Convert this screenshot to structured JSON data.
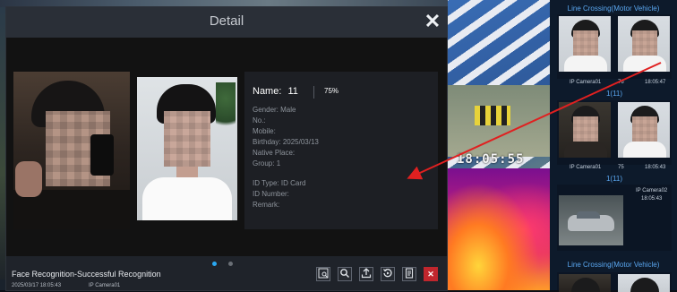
{
  "dialog": {
    "title": "Detail",
    "close_icon": "close-icon",
    "name_label": "Name:",
    "name_value": "11",
    "similarity": "75%",
    "fields": [
      {
        "label": "Gender:",
        "value": "Male"
      },
      {
        "label": "No.:",
        "value": ""
      },
      {
        "label": "Mobile:",
        "value": ""
      },
      {
        "label": "Birthday:",
        "value": "2025/03/13"
      },
      {
        "label": "Native Place:",
        "value": ""
      },
      {
        "label": "Group:",
        "value": "1"
      },
      {
        "label": "ID Type:",
        "value": "ID Card"
      },
      {
        "label": "ID Number:",
        "value": ""
      },
      {
        "label": "Remark:",
        "value": ""
      }
    ],
    "page_indicator": {
      "current": 1,
      "total": 2
    },
    "event_title": "Face Recognition-Successful Recognition",
    "event_time": "2025/03/17 18:05:43",
    "event_camera": "IP Camera01",
    "toolbar_icons": [
      "image-search-icon",
      "search-icon",
      "export-icon",
      "playback-icon",
      "document-icon",
      "close-icon"
    ]
  },
  "video": {
    "clock": "18:05:55"
  },
  "sidebar": {
    "header": "Line Crossing(Motor Vehicle)",
    "cards": [
      {
        "camera": "IP Camera01",
        "index": "76",
        "time": "18:05:47",
        "count": "1(11)"
      },
      {
        "camera": "IP Camera01",
        "index": "75",
        "time": "18:05:43",
        "count": "1(11)"
      },
      {
        "camera": "IP Camera02",
        "time": "18:05:43"
      }
    ],
    "footer_header": "Line Crossing(Motor Vehicle)"
  },
  "colors": {
    "accent": "#5aa7f0",
    "dialog_bg": "#1f232a",
    "close_button": "#c0262d",
    "arrow": "#e02020"
  }
}
